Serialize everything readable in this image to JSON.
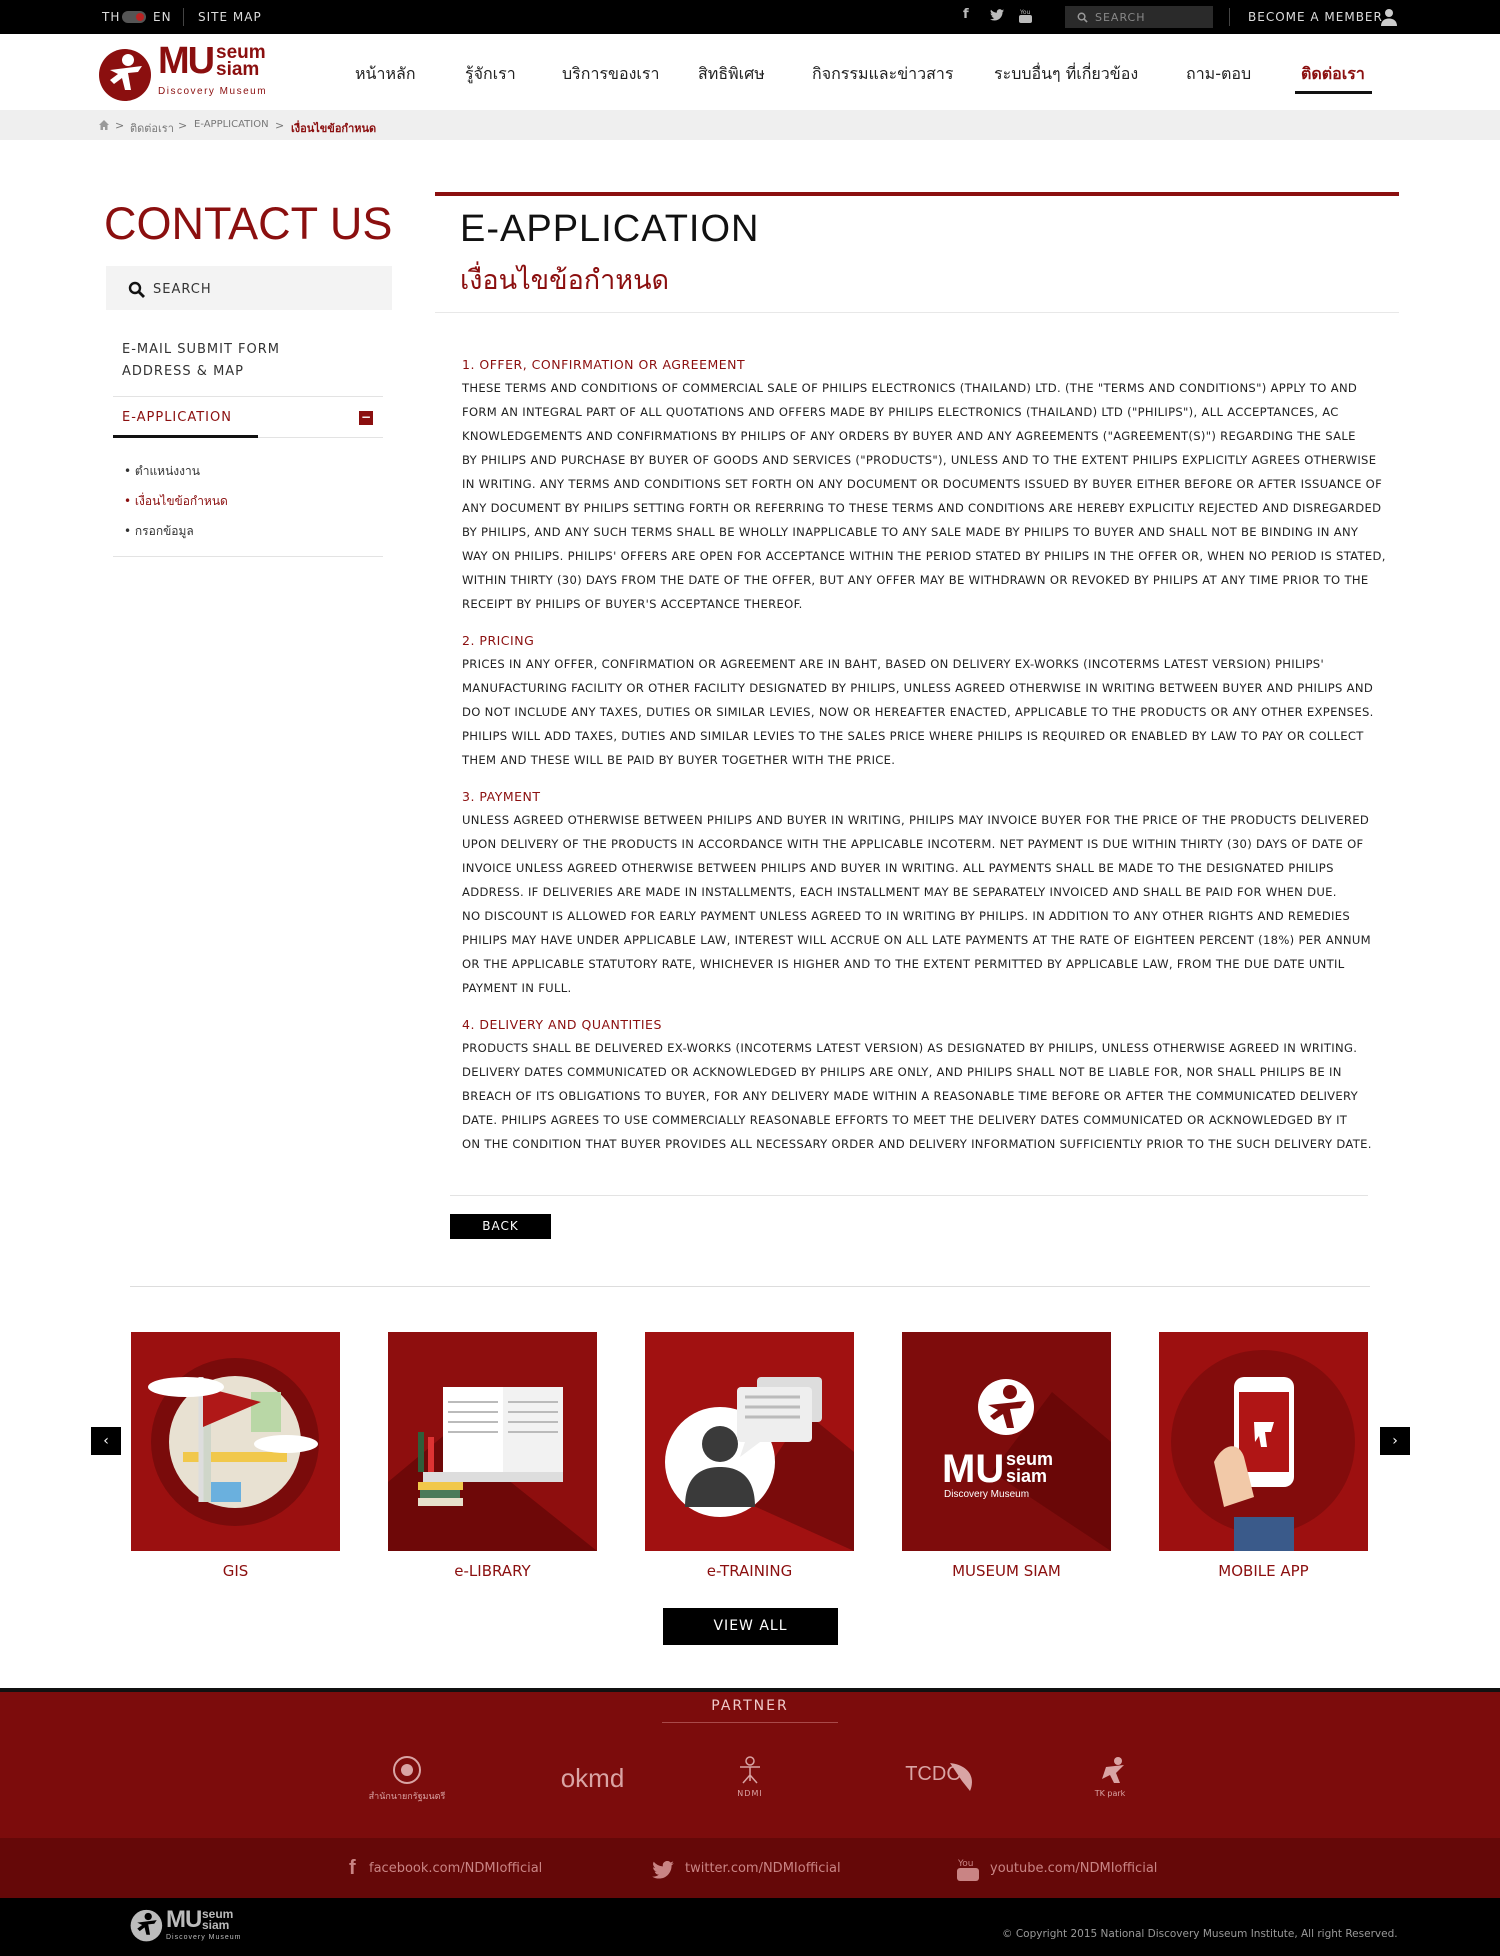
{
  "topbar": {
    "lang_th": "TH",
    "lang_en": "EN",
    "sitemap": "SITE MAP",
    "search_placeholder": "SEARCH",
    "become_member": "BECOME A MEMBER",
    "social_icons": [
      "facebook-icon",
      "twitter-icon",
      "youtube-icon"
    ]
  },
  "brand": {
    "logo_top": "seum",
    "logo_mu": "MU",
    "logo_bottom": "siam",
    "logo_tagline": "Discovery Museum",
    "accent_color": "#8b0f0f"
  },
  "nav": {
    "items": [
      {
        "label": "หน้าหลัก"
      },
      {
        "label": "รู้จักเรา"
      },
      {
        "label": "บริการของเรา"
      },
      {
        "label": "สิทธิพิเศษ"
      },
      {
        "label": "กิจกรรมและข่าวสาร"
      },
      {
        "label": "ระบบอื่นๆ ที่เกี่ยวข้อง"
      },
      {
        "label": "ถาม-ตอบ"
      },
      {
        "label": "ติดต่อเรา",
        "active": true
      }
    ]
  },
  "breadcrumb": {
    "items": [
      "ติดต่อเรา",
      "E-APPLICATION",
      "เงื่อนไขข้อกำหนด"
    ]
  },
  "sidebar": {
    "title": "CONTACT US",
    "search_placeholder": "SEARCH",
    "links": [
      "E-MAIL SUBMIT FORM",
      "ADDRESS & MAP"
    ],
    "section": "E-APPLICATION",
    "sub_items": [
      "ตำแหน่งงาน",
      "เงื่อนไขข้อกำหนด",
      "กรอกข้อมูล"
    ]
  },
  "main": {
    "title": "E-APPLICATION",
    "subtitle": "เงื่อนไขข้อกำหนด",
    "sections": [
      {
        "heading": "1. OFFER, CONFIRMATION OR AGREEMENT",
        "lines": [
          "THESE TERMS AND CONDITIONS OF COMMERCIAL SALE OF PHILIPS ELECTRONICS (THAILAND) LTD. (THE \"TERMS AND CONDITIONS\") APPLY TO AND",
          "FORM AN INTEGRAL PART OF ALL QUOTATIONS AND OFFERS MADE BY PHILIPS ELECTRONICS (THAILAND) LTD (\"PHILIPS\"), ALL ACCEPTANCES, AC",
          "KNOWLEDGEMENTS AND CONFIRMATIONS BY PHILIPS OF ANY ORDERS BY BUYER AND ANY AGREEMENTS (\"AGREEMENT(S)\") REGARDING THE SALE",
          "BY PHILIPS AND PURCHASE BY BUYER OF GOODS AND SERVICES (\"PRODUCTS\"), UNLESS AND TO THE EXTENT PHILIPS EXPLICITLY AGREES OTHERWISE",
          "IN WRITING. ANY TERMS AND CONDITIONS SET FORTH ON ANY DOCUMENT OR DOCUMENTS ISSUED BY BUYER EITHER BEFORE OR AFTER ISSUANCE OF",
          "ANY DOCUMENT BY PHILIPS SETTING FORTH OR REFERRING TO THESE TERMS AND CONDITIONS ARE HEREBY EXPLICITLY REJECTED AND DISREGARDED",
          "BY PHILIPS, AND ANY SUCH TERMS SHALL BE WHOLLY INAPPLICABLE TO ANY SALE MADE BY PHILIPS TO BUYER AND SHALL NOT BE BINDING IN ANY",
          "WAY ON PHILIPS. PHILIPS' OFFERS ARE OPEN FOR ACCEPTANCE WITHIN THE PERIOD STATED BY PHILIPS IN THE OFFER OR, WHEN NO PERIOD IS STATED,",
          "WITHIN THIRTY (30) DAYS FROM THE DATE OF THE OFFER, BUT ANY OFFER MAY BE WITHDRAWN OR REVOKED BY PHILIPS AT ANY TIME PRIOR TO THE",
          "RECEIPT BY PHILIPS OF BUYER'S ACCEPTANCE THEREOF."
        ]
      },
      {
        "heading": "2. PRICING",
        "lines": [
          "PRICES IN ANY OFFER, CONFIRMATION OR AGREEMENT ARE IN BAHT, BASED ON DELIVERY EX-WORKS (INCOTERMS LATEST VERSION) PHILIPS'",
          "MANUFACTURING FACILITY OR OTHER FACILITY DESIGNATED BY PHILIPS, UNLESS AGREED OTHERWISE IN WRITING BETWEEN BUYER AND PHILIPS AND",
          "DO NOT INCLUDE ANY TAXES, DUTIES OR SIMILAR LEVIES, NOW OR HEREAFTER ENACTED, APPLICABLE TO THE PRODUCTS OR ANY OTHER EXPENSES.",
          "PHILIPS WILL ADD TAXES, DUTIES AND SIMILAR LEVIES TO THE SALES PRICE WHERE PHILIPS IS REQUIRED OR ENABLED BY LAW TO PAY OR COLLECT",
          "THEM AND THESE WILL BE PAID BY BUYER TOGETHER WITH THE PRICE."
        ]
      },
      {
        "heading": "3. PAYMENT",
        "lines": [
          "UNLESS AGREED OTHERWISE BETWEEN PHILIPS AND BUYER IN WRITING, PHILIPS MAY INVOICE BUYER FOR THE PRICE OF THE PRODUCTS DELIVERED",
          "UPON DELIVERY OF THE PRODUCTS IN ACCORDANCE WITH THE APPLICABLE INCOTERM. NET PAYMENT IS DUE WITHIN THIRTY (30) DAYS OF DATE OF",
          "INVOICE UNLESS AGREED OTHERWISE BETWEEN PHILIPS AND BUYER IN WRITING. ALL PAYMENTS SHALL BE MADE TO THE DESIGNATED PHILIPS",
          "ADDRESS. IF DELIVERIES ARE MADE IN INSTALLMENTS, EACH INSTALLMENT MAY BE SEPARATELY INVOICED AND SHALL BE PAID FOR WHEN DUE.",
          "NO DISCOUNT IS ALLOWED FOR EARLY PAYMENT UNLESS AGREED TO IN WRITING BY PHILIPS. IN ADDITION TO ANY OTHER RIGHTS AND REMEDIES",
          "PHILIPS MAY HAVE UNDER APPLICABLE LAW, INTEREST WILL ACCRUE ON ALL LATE PAYMENTS AT THE RATE OF EIGHTEEN PERCENT (18%) PER ANNUM",
          "OR THE APPLICABLE STATUTORY RATE, WHICHEVER IS HIGHER AND TO THE EXTENT PERMITTED BY APPLICABLE LAW, FROM THE DUE DATE UNTIL",
          "PAYMENT IN FULL."
        ]
      },
      {
        "heading": "4. DELIVERY AND QUANTITIES",
        "lines": [
          "PRODUCTS SHALL BE DELIVERED EX-WORKS (INCOTERMS LATEST VERSION) AS DESIGNATED BY PHILIPS, UNLESS OTHERWISE AGREED IN WRITING.",
          "DELIVERY DATES COMMUNICATED OR ACKNOWLEDGED BY PHILIPS ARE ONLY, AND PHILIPS SHALL NOT BE LIABLE FOR, NOR SHALL PHILIPS BE IN",
          "BREACH OF ITS OBLIGATIONS TO BUYER, FOR ANY DELIVERY MADE WITHIN A REASONABLE TIME BEFORE OR AFTER THE COMMUNICATED DELIVERY",
          "DATE. PHILIPS AGREES TO USE COMMERCIALLY REASONABLE EFFORTS TO MEET THE DELIVERY DATES COMMUNICATED OR ACKNOWLEDGED BY IT",
          "ON THE CONDITION THAT BUYER PROVIDES ALL NECESSARY ORDER AND DELIVERY INFORMATION SUFFICIENTLY PRIOR TO THE SUCH DELIVERY DATE."
        ]
      }
    ],
    "back_label": "BACK"
  },
  "services": {
    "tiles": [
      {
        "label": "GIS",
        "icon": "map-flag-icon"
      },
      {
        "label": "e-LIBRARY",
        "icon": "book-icon"
      },
      {
        "label": "e-TRAINING",
        "icon": "person-chat-icon"
      },
      {
        "label": "MUSEUM SIAM",
        "icon": "museum-logo-icon"
      },
      {
        "label": "MOBILE APP",
        "icon": "smartphone-icon"
      }
    ],
    "view_all": "VIEW ALL"
  },
  "partner": {
    "title": "PARTNER",
    "logos": [
      {
        "name": "soc-seal-logo",
        "text": "สำนักนายกรัฐมนตรี"
      },
      {
        "name": "okmd-logo",
        "text": "okmd"
      },
      {
        "name": "ndmi-logo",
        "text": "NDMI"
      },
      {
        "name": "tcdc-logo",
        "text": "TCDC"
      },
      {
        "name": "tkpark-logo",
        "text": "TK park"
      }
    ]
  },
  "social": {
    "facebook": "facebook.com/NDMIofficial",
    "twitter": "twitter.com/NDMIofficial",
    "youtube": "youtube.com/NDMIofficial"
  },
  "footer": {
    "copyright": "Copyright 2015 National Discovery Museum Institute, All right Reserved."
  }
}
